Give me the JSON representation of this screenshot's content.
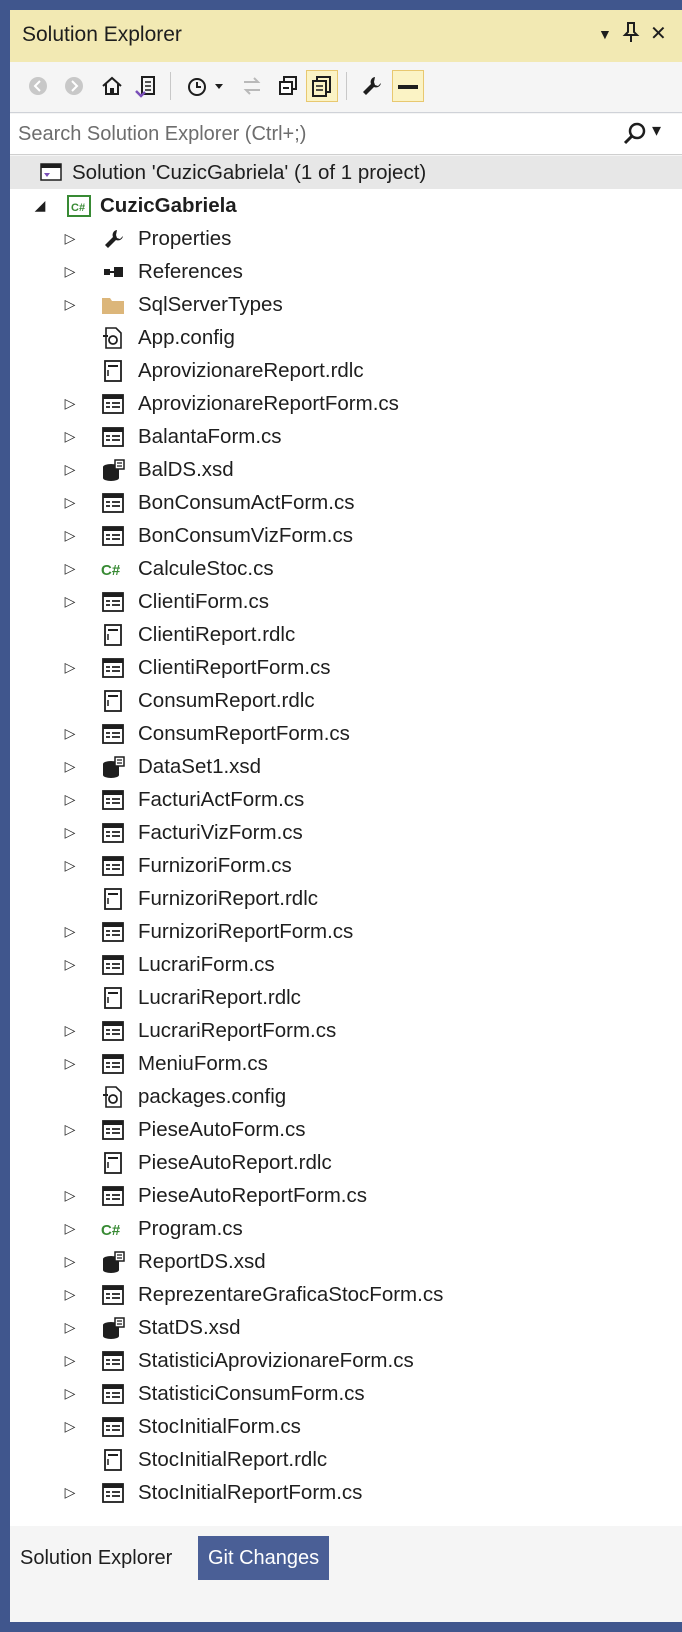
{
  "panel": {
    "title": "Solution Explorer",
    "dropdown_glyph": "▼",
    "pin_glyph": "📌",
    "close_glyph": "✕"
  },
  "search": {
    "placeholder": "Search Solution Explorer (Ctrl+;)",
    "options_glyph": "▾"
  },
  "tree": {
    "solution_label": "Solution 'CuzicGabriela' (1 of 1 project)",
    "project_label": "CuzicGabriela",
    "items": [
      {
        "label": "Properties",
        "icon": "wrench-icon",
        "expandable": true
      },
      {
        "label": "References",
        "icon": "references-icon",
        "expandable": true
      },
      {
        "label": "SqlServerTypes",
        "icon": "folder-icon",
        "expandable": true
      },
      {
        "label": "App.config",
        "icon": "config-icon",
        "expandable": false
      },
      {
        "label": "AprovizionareReport.rdlc",
        "icon": "report-icon",
        "expandable": false
      },
      {
        "label": "AprovizionareReportForm.cs",
        "icon": "form-icon",
        "expandable": true
      },
      {
        "label": "BalantaForm.cs",
        "icon": "form-icon",
        "expandable": true
      },
      {
        "label": "BalDS.xsd",
        "icon": "dataset-icon",
        "expandable": true
      },
      {
        "label": "BonConsumActForm.cs",
        "icon": "form-icon",
        "expandable": true
      },
      {
        "label": "BonConsumVizForm.cs",
        "icon": "form-icon",
        "expandable": true
      },
      {
        "label": "CalculeStoc.cs",
        "icon": "csharp-icon",
        "expandable": true
      },
      {
        "label": "ClientiForm.cs",
        "icon": "form-icon",
        "expandable": true
      },
      {
        "label": "ClientiReport.rdlc",
        "icon": "report-icon",
        "expandable": false
      },
      {
        "label": "ClientiReportForm.cs",
        "icon": "form-icon",
        "expandable": true
      },
      {
        "label": "ConsumReport.rdlc",
        "icon": "report-icon",
        "expandable": false
      },
      {
        "label": "ConsumReportForm.cs",
        "icon": "form-icon",
        "expandable": true
      },
      {
        "label": "DataSet1.xsd",
        "icon": "dataset-icon",
        "expandable": true
      },
      {
        "label": "FacturiActForm.cs",
        "icon": "form-icon",
        "expandable": true
      },
      {
        "label": "FacturiVizForm.cs",
        "icon": "form-icon",
        "expandable": true
      },
      {
        "label": "FurnizoriForm.cs",
        "icon": "form-icon",
        "expandable": true
      },
      {
        "label": "FurnizoriReport.rdlc",
        "icon": "report-icon",
        "expandable": false
      },
      {
        "label": "FurnizoriReportForm.cs",
        "icon": "form-icon",
        "expandable": true
      },
      {
        "label": "LucrariForm.cs",
        "icon": "form-icon",
        "expandable": true
      },
      {
        "label": "LucrariReport.rdlc",
        "icon": "report-icon",
        "expandable": false
      },
      {
        "label": "LucrariReportForm.cs",
        "icon": "form-icon",
        "expandable": true
      },
      {
        "label": "MeniuForm.cs",
        "icon": "form-icon",
        "expandable": true
      },
      {
        "label": "packages.config",
        "icon": "config-icon",
        "expandable": false
      },
      {
        "label": "PieseAutoForm.cs",
        "icon": "form-icon",
        "expandable": true
      },
      {
        "label": "PieseAutoReport.rdlc",
        "icon": "report-icon",
        "expandable": false
      },
      {
        "label": "PieseAutoReportForm.cs",
        "icon": "form-icon",
        "expandable": true
      },
      {
        "label": "Program.cs",
        "icon": "csharp-icon",
        "expandable": true
      },
      {
        "label": "ReportDS.xsd",
        "icon": "dataset-icon",
        "expandable": true
      },
      {
        "label": "ReprezentareGraficaStocForm.cs",
        "icon": "form-icon",
        "expandable": true
      },
      {
        "label": "StatDS.xsd",
        "icon": "dataset-icon",
        "expandable": true
      },
      {
        "label": "StatisticiAprovizionareForm.cs",
        "icon": "form-icon",
        "expandable": true
      },
      {
        "label": "StatisticiConsumForm.cs",
        "icon": "form-icon",
        "expandable": true
      },
      {
        "label": "StocInitialForm.cs",
        "icon": "form-icon",
        "expandable": true
      },
      {
        "label": "StocInitialReport.rdlc",
        "icon": "report-icon",
        "expandable": false
      },
      {
        "label": "StocInitialReportForm.cs",
        "icon": "form-icon",
        "expandable": true
      }
    ]
  },
  "tabs": [
    {
      "label": "Solution Explorer",
      "active": true
    },
    {
      "label": "Git Changes",
      "active": false
    }
  ],
  "colors": {
    "frame": "#40568d",
    "titlebar_active": "#f2e9b3",
    "toggle_on": "#fbf3c5",
    "csharp_green": "#388a34"
  }
}
